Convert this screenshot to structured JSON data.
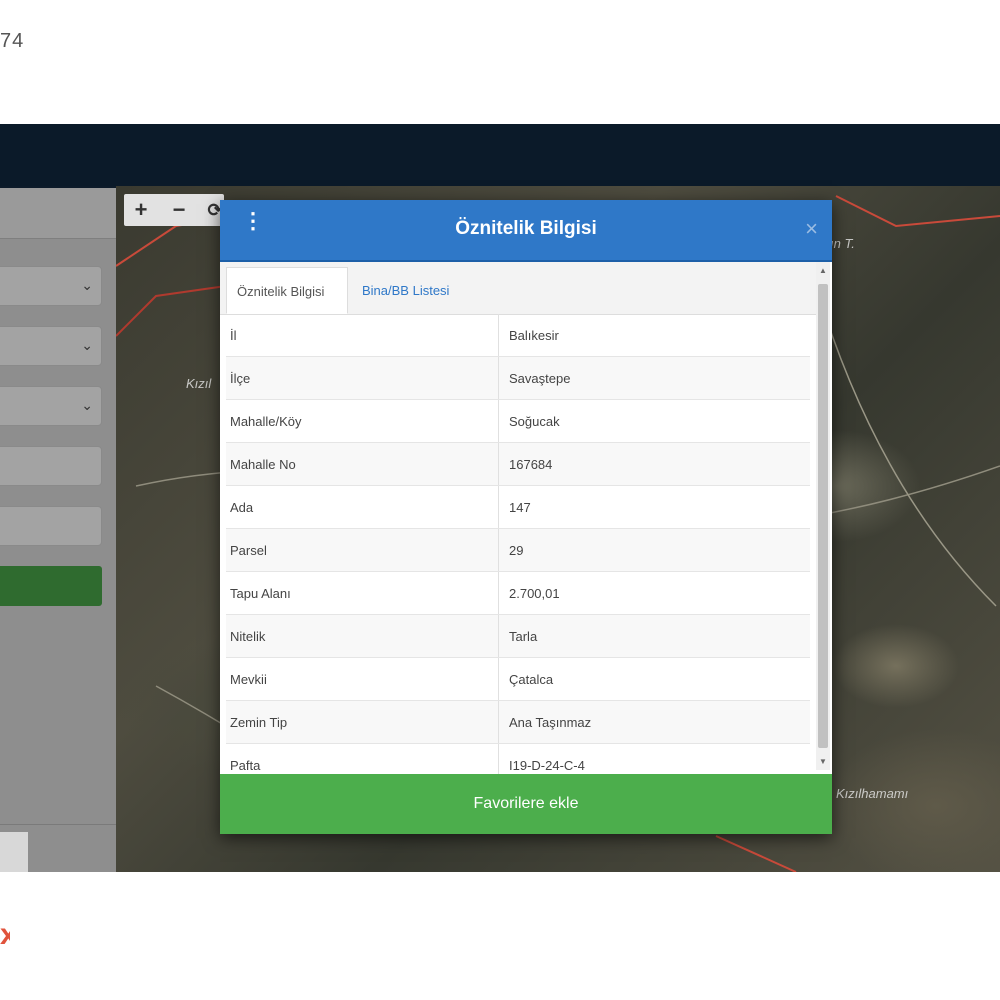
{
  "corner_text": "74",
  "corner_mark": "x",
  "map": {
    "labels": [
      "Kızıl",
      "ın T.",
      "Kızılhamamı"
    ]
  },
  "zoom": {
    "in": "+",
    "out": "−",
    "extra": "⟳"
  },
  "dialog": {
    "title": "Öznitelik Bilgisi",
    "close": "×",
    "menu": "⋮",
    "tabs": [
      {
        "label": "Öznitelik Bilgisi"
      },
      {
        "label": "Bina/BB Listesi"
      }
    ],
    "rows": [
      {
        "key": "İl",
        "value": "Balıkesir"
      },
      {
        "key": "İlçe",
        "value": "Savaştepe"
      },
      {
        "key": "Mahalle/Köy",
        "value": "Soğucak"
      },
      {
        "key": "Mahalle No",
        "value": "167684"
      },
      {
        "key": "Ada",
        "value": "147"
      },
      {
        "key": "Parsel",
        "value": "29"
      },
      {
        "key": "Tapu Alanı",
        "value": "2.700,01"
      },
      {
        "key": "Nitelik",
        "value": "Tarla"
      },
      {
        "key": "Mevkii",
        "value": "Çatalca"
      },
      {
        "key": "Zemin Tip",
        "value": "Ana Taşınmaz"
      },
      {
        "key": "Pafta",
        "value": "I19-D-24-C-4"
      }
    ],
    "favorite_label": "Favorilere ekle"
  },
  "sidebar": {
    "chevron": "⌄"
  }
}
